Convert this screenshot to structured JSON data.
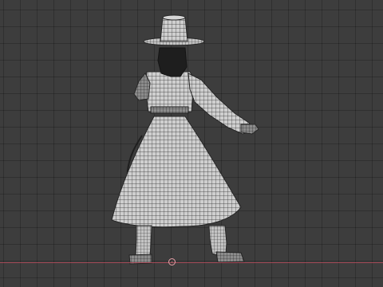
{
  "viewport": {
    "name": "3D viewport",
    "background": "#3d3d3d",
    "grid_color": "#353535",
    "x_axis_color": "#b54a5a",
    "origin_icon": "3d-cursor-icon"
  },
  "model": {
    "display": "wireframe-over-solid",
    "mesh_color": "#d9d9d9",
    "wire_color": "#2a2a2a",
    "subject": "character-back-view"
  }
}
